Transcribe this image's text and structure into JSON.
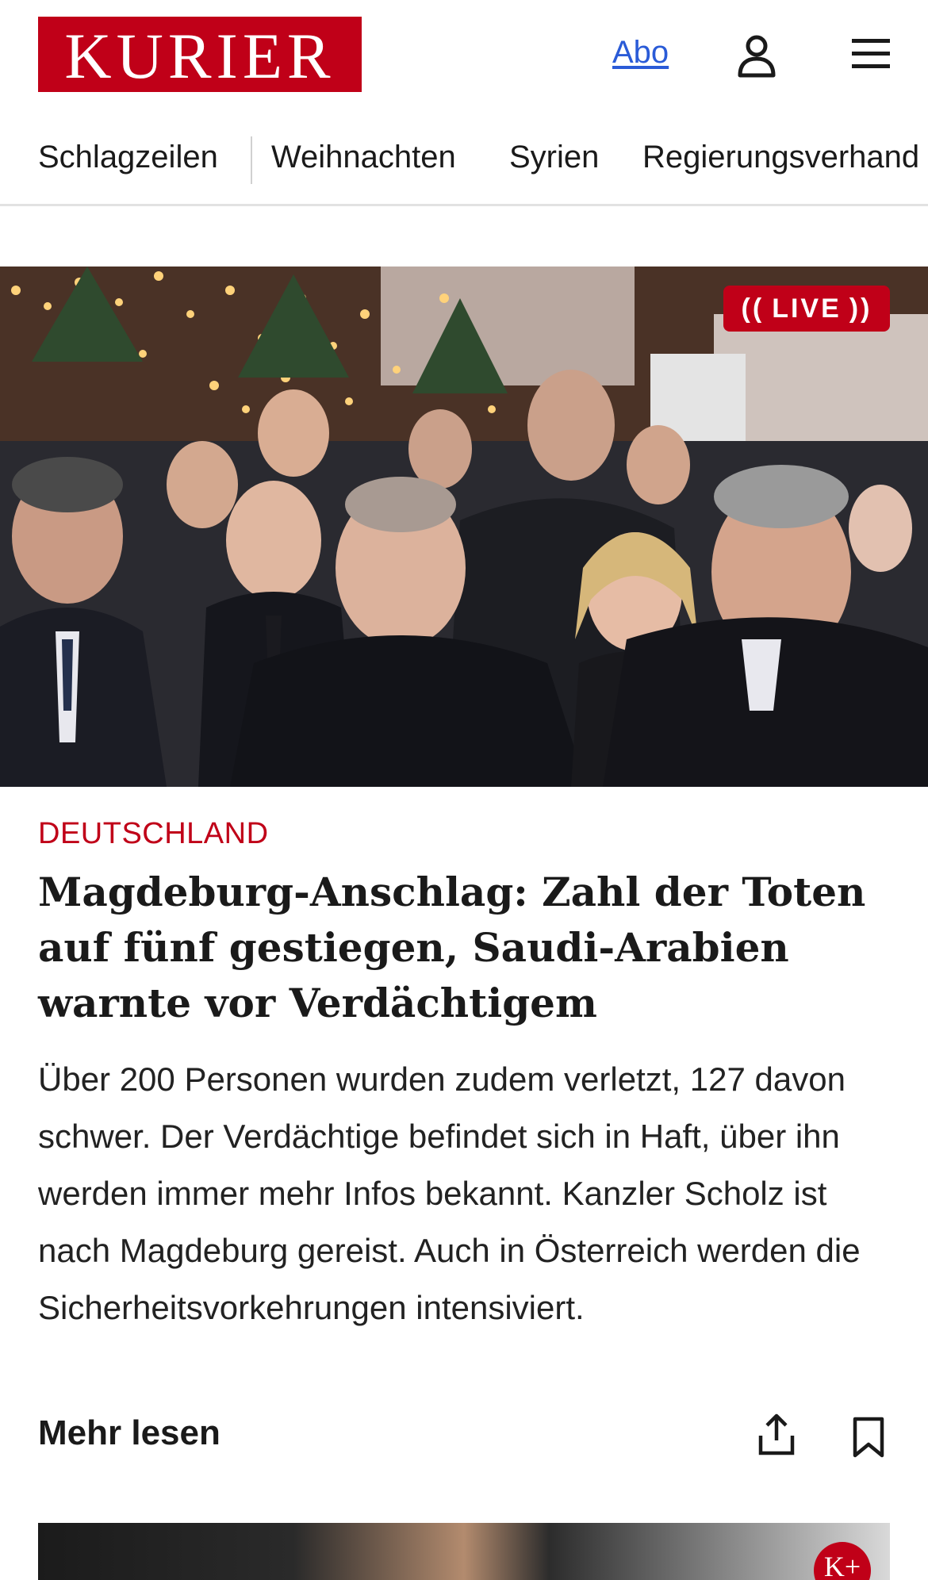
{
  "header": {
    "logo_text": "KURIER",
    "abo_label": "Abo",
    "user_icon": "user-icon",
    "menu_icon": "hamburger-menu-icon"
  },
  "nav": {
    "items": [
      "Schlagzeilen",
      "Weihnachten",
      "Syrien",
      "Regierungsverhand"
    ]
  },
  "hero": {
    "live_label": "LIVE"
  },
  "article": {
    "section": "DEUTSCHLAND",
    "headline": "Magdeburg-Anschlag: Zahl der Toten auf fünf gestiegen, Saudi-Arabien warnte vor Verdächtigem",
    "teaser": "Über 200 Personen wurden zudem verletzt, 127 davon schwer. Der Verdächtige befindet sich in Haft, über ihn werden immer mehr Infos bekannt. Kanzler Scholz ist nach Magdeburg gereist. Auch in Österreich werden die Sicherheitsvorkehrungen intensiviert.",
    "more_label": "Mehr lesen",
    "share_icon": "share-icon",
    "bookmark_icon": "bookmark-icon"
  },
  "next_card": {
    "badge": "K+"
  },
  "colors": {
    "brand_red": "#c00018",
    "link_blue": "#2a5bd7"
  }
}
